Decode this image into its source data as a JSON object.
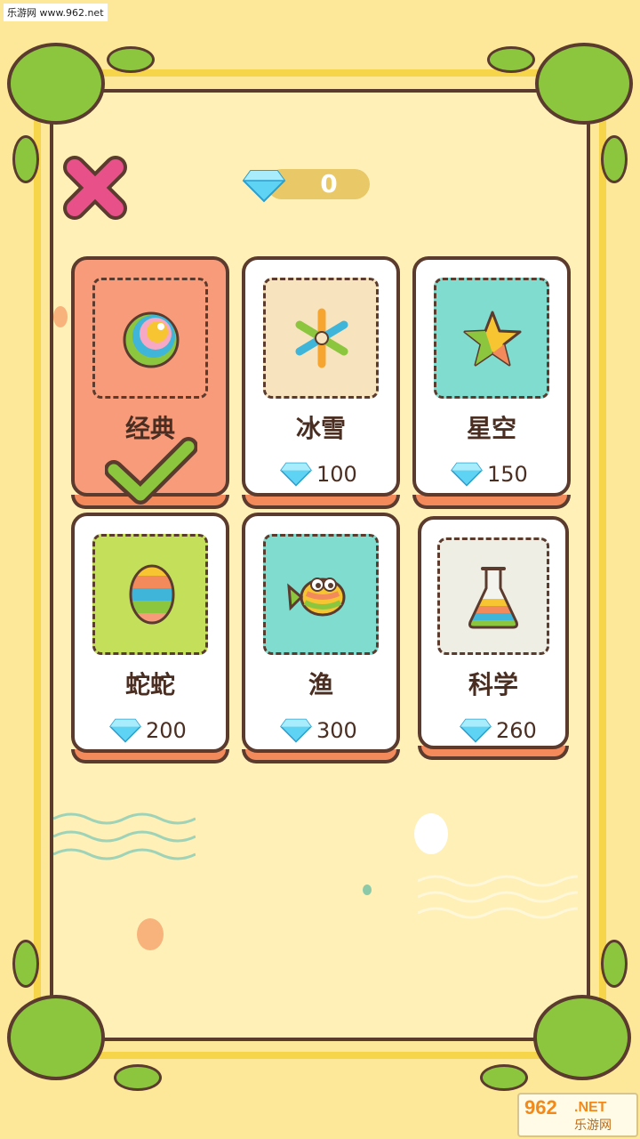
{
  "watermark": "乐游网 www.962.net",
  "header": {
    "gem_count": "0"
  },
  "themes": [
    {
      "name": "经典",
      "price": "",
      "selected": true
    },
    {
      "name": "冰雪",
      "price": "100",
      "selected": false
    },
    {
      "name": "星空",
      "price": "150",
      "selected": false
    },
    {
      "name": "蛇蛇",
      "price": "200",
      "selected": false
    },
    {
      "name": "渔",
      "price": "300",
      "selected": false
    },
    {
      "name": "科学",
      "price": "260",
      "selected": false
    }
  ],
  "corner_logo": {
    "number": "962",
    "suffix": ".NET",
    "site_name": "乐游网"
  },
  "colors": {
    "background": "#fde89a",
    "card_selected": "#f79b7b",
    "accent_check": "#8cc63f",
    "close": "#e8508a"
  }
}
